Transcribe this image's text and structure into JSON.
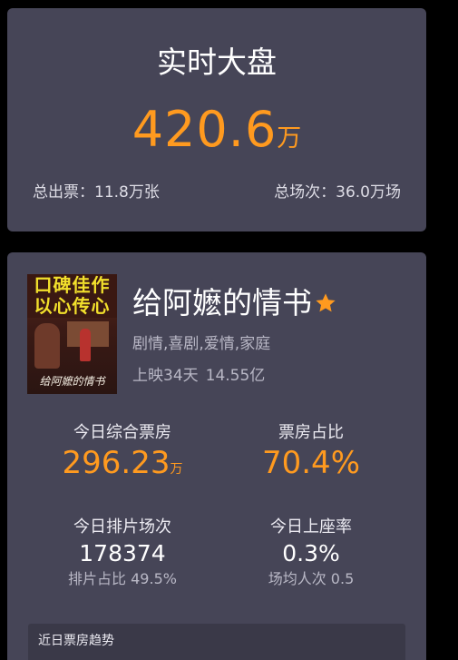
{
  "total": {
    "title": "实时大盘",
    "value": "420.6",
    "unit": "万",
    "tickets": "总出票：11.8万张",
    "shows": "总场次：36.0万场"
  },
  "movie": {
    "poster": {
      "tagline": "口碑佳作\n以心传心",
      "title": "给阿嬷的情书"
    },
    "title": "给阿嬷的情书",
    "genres": "剧情,喜剧,爱情,家庭",
    "release_days": "上映34天",
    "total_gross": "14.55亿",
    "stats": {
      "today_box_office": {
        "label": "今日综合票房",
        "value": "296.23",
        "unit": "万"
      },
      "box_office_share": {
        "label": "票房占比",
        "value": "70.4%"
      },
      "today_shows": {
        "label": "今日排片场次",
        "value": "178374",
        "sub": "排片占比 49.5%"
      },
      "today_occupancy": {
        "label": "今日上座率",
        "value": "0.3%",
        "sub": "场均人次 0.5"
      }
    },
    "trend_label": "近日票房趋势"
  },
  "colors": {
    "background": "#000000",
    "card": "#464557",
    "accent_orange": "#ff9a1f",
    "text_secondary": "#b9b8c6"
  },
  "icons": {
    "favorite": "star-icon"
  }
}
